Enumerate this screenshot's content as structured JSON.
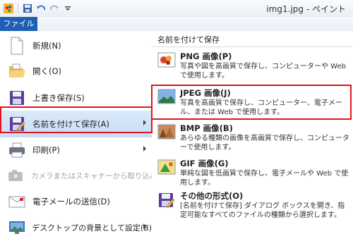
{
  "window": {
    "title": "img1.jpg - ペイント"
  },
  "ribbon": {
    "file_tab": "ファイル"
  },
  "menu": {
    "items": [
      {
        "label": "新規(N)",
        "icon": "new-document-icon",
        "has_submenu": false
      },
      {
        "label": "開く(O)",
        "icon": "open-folder-icon",
        "has_submenu": false
      },
      {
        "label": "上書き保存(S)",
        "icon": "save-floppy-icon",
        "has_submenu": false
      },
      {
        "label": "名前を付けて保存(A)",
        "icon": "save-as-icon",
        "has_submenu": true
      },
      {
        "label": "印刷(P)",
        "icon": "printer-icon",
        "has_submenu": true
      },
      {
        "label": "カメラまたはスキャナーから取り込み(M)",
        "icon": "camera-scanner-icon",
        "has_submenu": false
      },
      {
        "label": "電子メールの送信(D)",
        "icon": "email-icon",
        "has_submenu": false
      },
      {
        "label": "デスクトップの背景として設定(B)",
        "icon": "desktop-background-icon",
        "has_submenu": true
      }
    ]
  },
  "save_as_panel": {
    "header": "名前を付けて保存",
    "formats": [
      {
        "name": "PNG 画像(P)",
        "desc": "写真や図を高画質で保存し、コンピューターや Web で使用します。",
        "icon": "png-image-icon"
      },
      {
        "name": "JPEG 画像(J)",
        "desc": "写真を高画質で保存し、コンピューター、電子メール、または Web で使用します。",
        "icon": "jpeg-image-icon"
      },
      {
        "name": "BMP 画像(B)",
        "desc": "あらゆる種類の画像を高画質で保存し、コンピューターで使用します。",
        "icon": "bmp-image-icon"
      },
      {
        "name": "GIF 画像(G)",
        "desc": "単純な図を低画質で保存し、電子メールや Web で使用します。",
        "icon": "gif-image-icon"
      },
      {
        "name": "その他の形式(O)",
        "desc": "[名前を付けて保存] ダイアログ ボックスを開き、指定可能なすべてのファイルの種類から選択します。",
        "icon": "other-format-icon"
      }
    ]
  },
  "colors": {
    "accent": "#1e5fb3",
    "highlight_border": "#e0141e"
  }
}
